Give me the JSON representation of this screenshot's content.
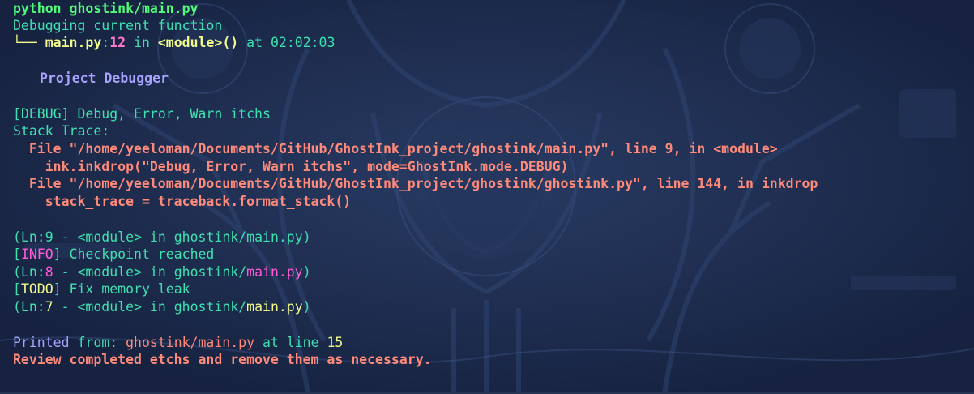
{
  "header": {
    "command": "python ghostink/main.py",
    "subtitle": "Debugging current function",
    "tree_prefix": "└── ",
    "file": "main.py",
    "colon": ":",
    "line_no": "12",
    "in_word": " in ",
    "module": "<module>()",
    "at_word": " at ",
    "time": "02:02:03"
  },
  "title": "Project Debugger",
  "debug": {
    "tag": "[DEBUG]",
    "message": " Debug, Error, Warn itchs",
    "stack_label": "Stack Trace:",
    "trace": [
      "  File \"/home/yeeloman/Documents/GitHub/GhostInk_project/ghostink/main.py\", line 9, in <module>",
      "    ink.inkdrop(\"Debug, Error, Warn itchs\", mode=GhostInk.mode.DEBUG)",
      "  File \"/home/yeeloman/Documents/GitHub/GhostInk_project/ghostink/ghostink.py\", line 144, in inkdrop",
      "    stack_trace = traceback.format_stack()"
    ],
    "location": {
      "open": "(Ln:",
      "ln": "9",
      "sep": " - ",
      "module": "<module>",
      "in": " in ",
      "dir": "ghostink/",
      "file": "main.py",
      "close": ")"
    }
  },
  "info": {
    "open_bracket": "[",
    "tag": "INFO",
    "close_bracket": "]",
    "message": " Checkpoint reached",
    "location": {
      "open": "(Ln:",
      "ln": "8",
      "sep": " - ",
      "module": "<module>",
      "in": " in ",
      "dir": "ghostink/",
      "file": "main.py",
      "close": ")"
    }
  },
  "todo": {
    "open_bracket": "[",
    "tag": "TODO",
    "close_bracket": "]",
    "message": " Fix memory leak",
    "location": {
      "open": "(Ln:",
      "ln": "7",
      "sep": " - ",
      "module": "<module>",
      "in": " in ",
      "dir": "ghostink/",
      "file": "main.py",
      "close": ")"
    }
  },
  "footer": {
    "printed_label": "Printed",
    "from_label": " from:",
    "path": " ghostink/main.py",
    "at_line": " at line ",
    "line_no": "15",
    "review": "Review completed etchs and remove them as necessary."
  },
  "colors": {
    "background": "#1a2744",
    "green": "#50fa7b",
    "teal": "#3ee0b0",
    "yellow": "#f1fa8c",
    "magenta": "#ff79c6",
    "purple": "#a9a3ff",
    "salmon": "#ff8a7a"
  }
}
